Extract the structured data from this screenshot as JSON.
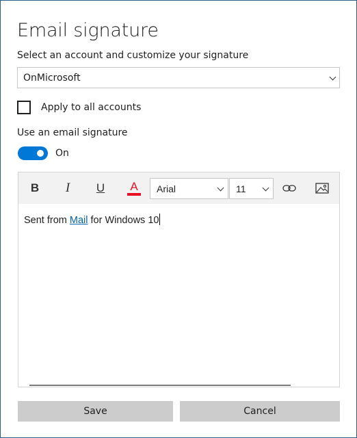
{
  "dialog": {
    "title": "Email signature",
    "subtitle": "Select an account and customize your signature"
  },
  "account_select": {
    "value": "OnMicrosoft",
    "icon": "chevron-down-icon"
  },
  "apply_all": {
    "label": "Apply to all accounts",
    "checked": false
  },
  "use_signature": {
    "label": "Use an email signature",
    "toggle_state": "On",
    "toggle_on": true,
    "accent_color": "#0078d7"
  },
  "toolbar": {
    "bold": "B",
    "italic": "I",
    "underline": "U",
    "font_color_letter": "A",
    "font_color": "#e81123",
    "font_family": "Arial",
    "font_size": "11",
    "link_icon": "link-icon",
    "image_icon": "image-icon"
  },
  "signature": {
    "text_before": "Sent from ",
    "link_text": "Mail",
    "text_after": " for Windows 10",
    "link_color": "#0063b1"
  },
  "buttons": {
    "save": "Save",
    "cancel": "Cancel"
  }
}
